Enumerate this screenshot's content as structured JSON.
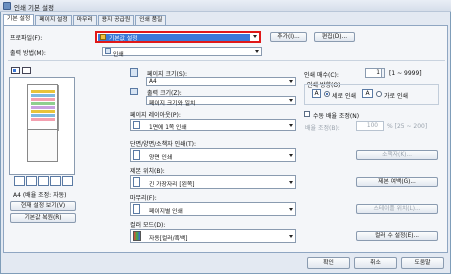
{
  "window": {
    "title": "인쇄 기본 설정"
  },
  "tabs": [
    "기본 설정",
    "페이지 설정",
    "마무리",
    "용지 공급원",
    "인쇄 품질"
  ],
  "profile": {
    "label": "프로파일(F):",
    "value": "기본값 설정",
    "add": "추가(I)...",
    "edit": "편집(D)..."
  },
  "output": {
    "label": "출력 방법(M):",
    "value": "인쇄"
  },
  "left_panel": {
    "status": "A4 (배율 조정: 자동)",
    "view_settings": "현재 설정 보기(V)",
    "restore": "기본값 복원(R)"
  },
  "page_size": {
    "label": "페이지 크기(S):",
    "value": "A4"
  },
  "output_size": {
    "label": "출력 크기(Z):",
    "value": "페이지 크기와 일치"
  },
  "copies": {
    "label": "인쇄 매수(C):",
    "value": "1",
    "range": "[1 ~ 9999]"
  },
  "orientation": {
    "label": "인쇄 방향(O)",
    "portrait": "세로 인쇄",
    "landscape": "가로 인쇄"
  },
  "layout": {
    "label": "페이지 레이아웃(P):",
    "value": "1면에 1쪽 인쇄"
  },
  "manual_scale": {
    "label": "수동 배율 조정(N)",
    "scale_label": "배율 조정(B):",
    "value": "100",
    "range": "% [25 ~ 200]"
  },
  "duplex": {
    "label": "단면/양면/소책자 인쇄(T):",
    "value": "양면 인쇄",
    "booklet_btn": "소책자(K)..."
  },
  "binding": {
    "label": "제본 위치(B):",
    "value": "긴 가장자리 [왼쪽]",
    "margin_btn": "제본 여백(G)..."
  },
  "finishing": {
    "label": "마무리(F):",
    "value": "페이지별 인쇄",
    "staple_btn": "스테이플 위치(L)..."
  },
  "color": {
    "label": "컬러 모드(D):",
    "value": "자동[컬러/흑백]",
    "color_btn": "컬러 수 설정(E)..."
  },
  "footer": {
    "ok": "확인",
    "cancel": "취소",
    "help": "도움말"
  }
}
